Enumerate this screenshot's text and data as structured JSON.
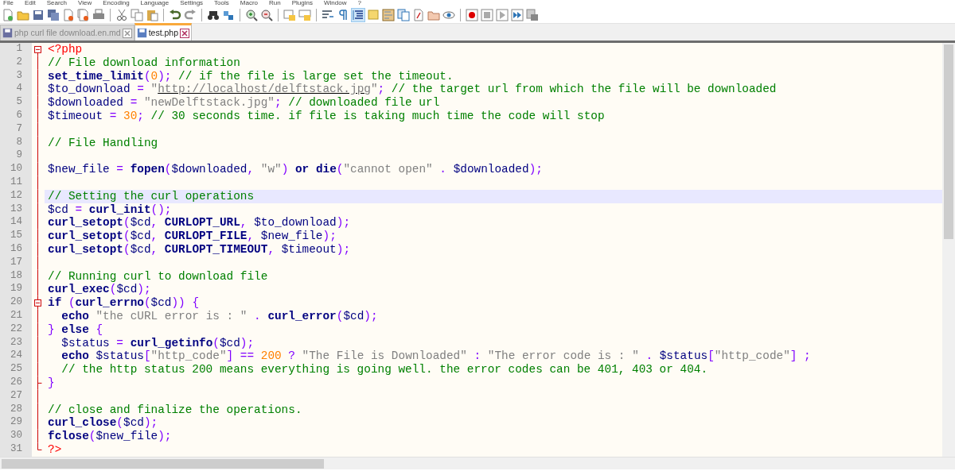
{
  "menu": [
    "File",
    "Edit",
    "Search",
    "View",
    "Encoding",
    "Language",
    "Settings",
    "Tools",
    "Macro",
    "Run",
    "Plugins",
    "Window",
    "?"
  ],
  "tabs": [
    {
      "label": "php curl file download.en.md",
      "selected": false
    },
    {
      "label": "test.php",
      "selected": true
    }
  ],
  "editor": {
    "lines": [
      {
        "number": "1",
        "fold_start": true,
        "tokens": [
          {
            "kind": "tag",
            "text": "<?php"
          }
        ]
      },
      {
        "number": "2",
        "tokens": [
          {
            "kind": "comment",
            "text": "// File download information"
          }
        ]
      },
      {
        "number": "3",
        "tokens": [
          {
            "kind": "func",
            "text": "set_time_limit"
          },
          {
            "kind": "op",
            "text": "("
          },
          {
            "kind": "num",
            "text": "0"
          },
          {
            "kind": "op",
            "text": ");"
          },
          {
            "kind": "comment",
            "text": " // if the file is large set the timeout."
          }
        ]
      },
      {
        "number": "4",
        "tokens": [
          {
            "kind": "var",
            "text": "$to_download"
          },
          {
            "kind": "op",
            "text": " = "
          },
          {
            "kind": "string",
            "text": "\""
          },
          {
            "kind": "link",
            "text": "http://localhost/delftstack.jpg"
          },
          {
            "kind": "string",
            "text": "\""
          },
          {
            "kind": "op",
            "text": ";"
          },
          {
            "kind": "comment",
            "text": " // the target url from which the file will be downloaded"
          }
        ]
      },
      {
        "number": "5",
        "tokens": [
          {
            "kind": "var",
            "text": "$downloaded"
          },
          {
            "kind": "op",
            "text": " = "
          },
          {
            "kind": "string",
            "text": "\"newDelftstack.jpg\""
          },
          {
            "kind": "op",
            "text": ";"
          },
          {
            "kind": "comment",
            "text": " // downloaded file url"
          }
        ]
      },
      {
        "number": "6",
        "tokens": [
          {
            "kind": "var",
            "text": "$timeout"
          },
          {
            "kind": "op",
            "text": " = "
          },
          {
            "kind": "num",
            "text": "30"
          },
          {
            "kind": "op",
            "text": ";"
          },
          {
            "kind": "comment",
            "text": " // 30 seconds time. if file is taking much time the code will stop"
          }
        ]
      },
      {
        "number": "7"
      },
      {
        "number": "8",
        "tokens": [
          {
            "kind": "comment",
            "text": "// File Handling"
          }
        ]
      },
      {
        "number": "9"
      },
      {
        "number": "10",
        "tokens": [
          {
            "kind": "var",
            "text": "$new_file"
          },
          {
            "kind": "op",
            "text": " = "
          },
          {
            "kind": "func",
            "text": "fopen"
          },
          {
            "kind": "op",
            "text": "("
          },
          {
            "kind": "var",
            "text": "$downloaded"
          },
          {
            "kind": "op",
            "text": ", "
          },
          {
            "kind": "string",
            "text": "\"w\""
          },
          {
            "kind": "op",
            "text": ") "
          },
          {
            "kind": "keyword",
            "text": "or"
          },
          {
            "kind": "func",
            "text": " die"
          },
          {
            "kind": "op",
            "text": "("
          },
          {
            "kind": "string",
            "text": "\"cannot open\""
          },
          {
            "kind": "op",
            "text": " . "
          },
          {
            "kind": "var",
            "text": "$downloaded"
          },
          {
            "kind": "op",
            "text": ");"
          }
        ]
      },
      {
        "number": "11"
      },
      {
        "number": "12",
        "current": true,
        "tokens": [
          {
            "kind": "comment",
            "text": "// Setting the curl operations"
          }
        ]
      },
      {
        "number": "13",
        "tokens": [
          {
            "kind": "var",
            "text": "$cd"
          },
          {
            "kind": "op",
            "text": " = "
          },
          {
            "kind": "func",
            "text": "curl_init"
          },
          {
            "kind": "op",
            "text": "();"
          }
        ]
      },
      {
        "number": "14",
        "tokens": [
          {
            "kind": "func",
            "text": "curl_setopt"
          },
          {
            "kind": "op",
            "text": "("
          },
          {
            "kind": "var",
            "text": "$cd"
          },
          {
            "kind": "op",
            "text": ", "
          },
          {
            "kind": "func",
            "text": "CURLOPT_URL"
          },
          {
            "kind": "op",
            "text": ", "
          },
          {
            "kind": "var",
            "text": "$to_download"
          },
          {
            "kind": "op",
            "text": ");"
          }
        ]
      },
      {
        "number": "15",
        "tokens": [
          {
            "kind": "func",
            "text": "curl_setopt"
          },
          {
            "kind": "op",
            "text": "("
          },
          {
            "kind": "var",
            "text": "$cd"
          },
          {
            "kind": "op",
            "text": ", "
          },
          {
            "kind": "func",
            "text": "CURLOPT_FILE"
          },
          {
            "kind": "op",
            "text": ", "
          },
          {
            "kind": "var",
            "text": "$new_file"
          },
          {
            "kind": "op",
            "text": ");"
          }
        ]
      },
      {
        "number": "16",
        "tokens": [
          {
            "kind": "func",
            "text": "curl_setopt"
          },
          {
            "kind": "op",
            "text": "("
          },
          {
            "kind": "var",
            "text": "$cd"
          },
          {
            "kind": "op",
            "text": ", "
          },
          {
            "kind": "func",
            "text": "CURLOPT_TIMEOUT"
          },
          {
            "kind": "op",
            "text": ", "
          },
          {
            "kind": "var",
            "text": "$timeout"
          },
          {
            "kind": "op",
            "text": ");"
          }
        ]
      },
      {
        "number": "17"
      },
      {
        "number": "18",
        "tokens": [
          {
            "kind": "comment",
            "text": "// Running curl to download file"
          }
        ]
      },
      {
        "number": "19",
        "tokens": [
          {
            "kind": "func",
            "text": "curl_exec"
          },
          {
            "kind": "op",
            "text": "("
          },
          {
            "kind": "var",
            "text": "$cd"
          },
          {
            "kind": "op",
            "text": ");"
          }
        ]
      },
      {
        "number": "20",
        "fold_start": true,
        "tokens": [
          {
            "kind": "keyword",
            "text": "if"
          },
          {
            "kind": "op",
            "text": " ("
          },
          {
            "kind": "func",
            "text": "curl_errno"
          },
          {
            "kind": "op",
            "text": "("
          },
          {
            "kind": "var",
            "text": "$cd"
          },
          {
            "kind": "op",
            "text": ")) {"
          }
        ]
      },
      {
        "number": "21",
        "tokens": [
          {
            "kind": "keyword",
            "text": "  echo"
          },
          {
            "kind": "string",
            "text": " \"the cURL error is : \""
          },
          {
            "kind": "op",
            "text": " . "
          },
          {
            "kind": "func",
            "text": "curl_error"
          },
          {
            "kind": "op",
            "text": "("
          },
          {
            "kind": "var",
            "text": "$cd"
          },
          {
            "kind": "op",
            "text": ");"
          }
        ]
      },
      {
        "number": "22",
        "tokens": [
          {
            "kind": "op",
            "text": "} "
          },
          {
            "kind": "keyword",
            "text": "else"
          },
          {
            "kind": "op",
            "text": " {"
          }
        ]
      },
      {
        "number": "23",
        "tokens": [
          {
            "kind": "var",
            "text": "  $status"
          },
          {
            "kind": "op",
            "text": " = "
          },
          {
            "kind": "func",
            "text": "curl_getinfo"
          },
          {
            "kind": "op",
            "text": "("
          },
          {
            "kind": "var",
            "text": "$cd"
          },
          {
            "kind": "op",
            "text": ");"
          }
        ]
      },
      {
        "number": "24",
        "tokens": [
          {
            "kind": "keyword",
            "text": "  echo"
          },
          {
            "kind": "var",
            "text": " $status"
          },
          {
            "kind": "op",
            "text": "["
          },
          {
            "kind": "string",
            "text": "\"http_code\""
          },
          {
            "kind": "op",
            "text": "] == "
          },
          {
            "kind": "num",
            "text": "200"
          },
          {
            "kind": "op",
            "text": " ? "
          },
          {
            "kind": "string",
            "text": "\"The File is Downloaded\""
          },
          {
            "kind": "op",
            "text": " : "
          },
          {
            "kind": "string",
            "text": "\"The error code is : \""
          },
          {
            "kind": "op",
            "text": " . "
          },
          {
            "kind": "var",
            "text": "$status"
          },
          {
            "kind": "op",
            "text": "["
          },
          {
            "kind": "string",
            "text": "\"http_code\""
          },
          {
            "kind": "op",
            "text": "] ;"
          }
        ]
      },
      {
        "number": "25",
        "tokens": [
          {
            "kind": "comment",
            "text": "  // the http status 200 means everything is going well. the error codes can be 401, 403 or 404."
          }
        ]
      },
      {
        "number": "26",
        "fold_end": true,
        "tokens": [
          {
            "kind": "op",
            "text": "}"
          }
        ]
      },
      {
        "number": "27"
      },
      {
        "number": "28",
        "tokens": [
          {
            "kind": "comment",
            "text": "// close and finalize the operations."
          }
        ]
      },
      {
        "number": "29",
        "tokens": [
          {
            "kind": "func",
            "text": "curl_close"
          },
          {
            "kind": "op",
            "text": "("
          },
          {
            "kind": "var",
            "text": "$cd"
          },
          {
            "kind": "op",
            "text": ");"
          }
        ]
      },
      {
        "number": "30",
        "tokens": [
          {
            "kind": "func",
            "text": "fclose"
          },
          {
            "kind": "op",
            "text": "("
          },
          {
            "kind": "var",
            "text": "$new_file"
          },
          {
            "kind": "op",
            "text": ");"
          }
        ]
      },
      {
        "number": "31",
        "fold_end": true,
        "tokens": [
          {
            "kind": "tag",
            "text": "?>"
          }
        ]
      }
    ]
  }
}
